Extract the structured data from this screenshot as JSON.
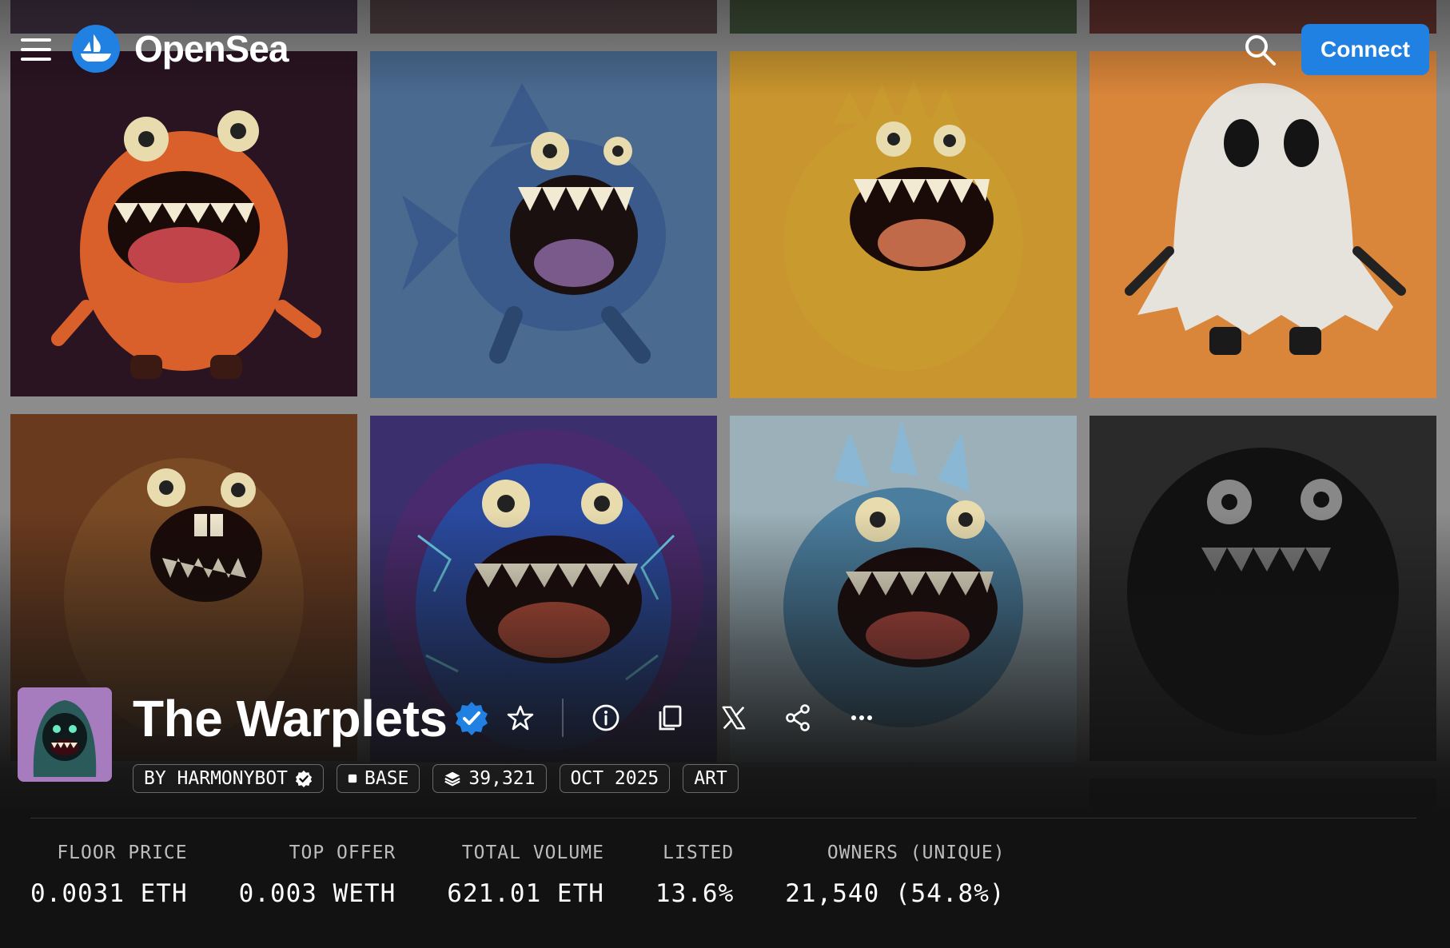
{
  "header": {
    "brand": "OpenSea",
    "connect_label": "Connect"
  },
  "gallery": {
    "items": [
      {
        "creature": "orange-dripping-monster",
        "bg": "#2a1422",
        "body": "#d9602a"
      },
      {
        "creature": "blue-fish-monster",
        "bg": "#4a6a90",
        "body": "#3a5a8c"
      },
      {
        "creature": "yellow-furry-monster",
        "bg": "#c8952e",
        "body": "#c99a2e"
      },
      {
        "creature": "white-ghost",
        "bg": "#d9853a",
        "body": "#e6e3dc"
      },
      {
        "creature": "brown-furry-monster",
        "bg": "#6a3a1e",
        "body": "#7a4a25"
      },
      {
        "creature": "electric-blue-monster",
        "bg": "#3b2f6e",
        "body": "#2a4aa0"
      },
      {
        "creature": "spiky-crystal-monster",
        "bg": "#9bb0b8",
        "body": "#4a7d9e"
      },
      {
        "creature": "black-shadow-monster",
        "bg": "#2a2a2a",
        "body": "#111111"
      }
    ]
  },
  "collection": {
    "name": "The Warplets",
    "tags": {
      "creator": "BY HARMONYBOT",
      "chain": "BASE",
      "items": "39,321",
      "date": "OCT 2025",
      "category": "ART"
    },
    "stats": [
      {
        "label": "FLOOR PRICE",
        "value": "0.0031 ETH"
      },
      {
        "label": "TOP OFFER",
        "value": "0.003 WETH"
      },
      {
        "label": "TOTAL VOLUME",
        "value": "621.01 ETH"
      },
      {
        "label": "LISTED",
        "value": "13.6%"
      },
      {
        "label": "OWNERS (UNIQUE)",
        "value": "21,540 (54.8%)"
      }
    ]
  },
  "colors": {
    "accent": "#2081e2",
    "verified": "#2081e2",
    "background": "#121212"
  }
}
